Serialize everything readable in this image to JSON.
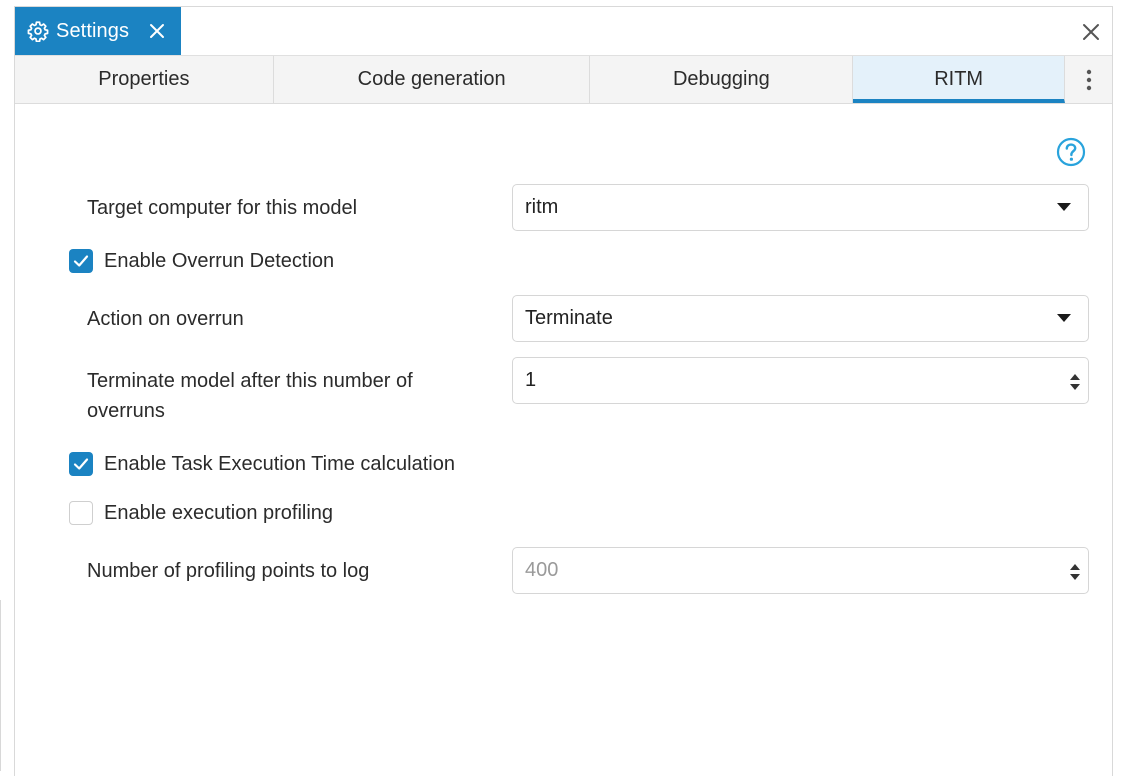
{
  "window": {
    "title": "Settings",
    "accent_color": "#1b83c2"
  },
  "tabs": [
    {
      "label": "Properties",
      "active": false
    },
    {
      "label": "Code generation",
      "active": false
    },
    {
      "label": "Debugging",
      "active": false
    },
    {
      "label": "RITM",
      "active": true
    }
  ],
  "icons": {
    "title": "gear-icon",
    "tab_close": "close-icon",
    "window_close": "close-icon",
    "more": "more-vertical-icon",
    "help": "help-icon"
  },
  "form": {
    "target_computer": {
      "label": "Target computer for this model",
      "value": "ritm"
    },
    "enable_overrun_detection": {
      "label": "Enable Overrun Detection",
      "checked": true
    },
    "action_on_overrun": {
      "label": "Action on overrun",
      "value": "Terminate"
    },
    "terminate_after": {
      "label_line1": "Terminate model after this number of",
      "label_line2": "overruns",
      "value": "1"
    },
    "enable_task_execution_time": {
      "label": "Enable Task Execution Time calculation",
      "checked": true
    },
    "enable_execution_profiling": {
      "label": "Enable execution profiling",
      "checked": false
    },
    "profiling_points": {
      "label": "Number of profiling points to log",
      "value": "400",
      "disabled": true
    }
  }
}
